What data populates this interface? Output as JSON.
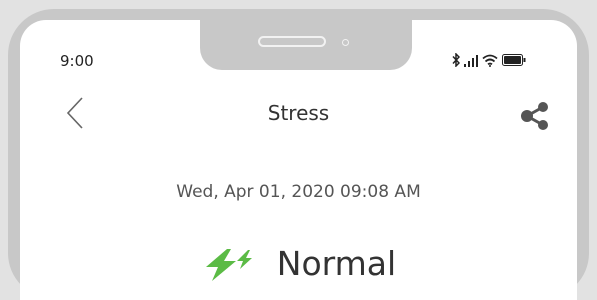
{
  "status_bar": {
    "time": "9:00"
  },
  "header": {
    "title": "Stress"
  },
  "reading": {
    "datetime": "Wed, Apr 01, 2020 09:08 AM",
    "status": "Normal",
    "status_color": "#5bbb45"
  },
  "icons": {
    "back": "chevron-left-icon",
    "share": "share-icon",
    "bolt": "lightning-bolt-icon",
    "bluetooth": "bluetooth-icon",
    "signal": "signal-icon",
    "wifi": "wifi-icon",
    "battery": "battery-icon"
  }
}
